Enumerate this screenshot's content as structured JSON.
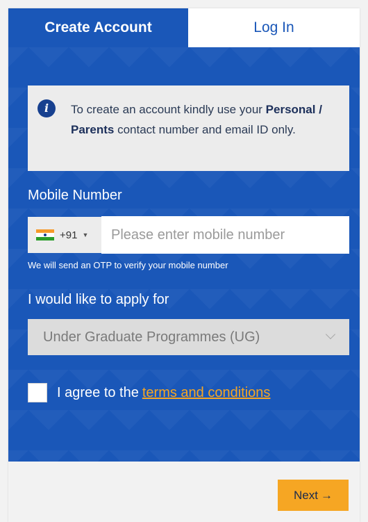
{
  "tabs": {
    "create_account": "Create Account",
    "log_in": "Log In"
  },
  "info": {
    "text_before": "To create an account kindly use your ",
    "text_bold": "Personal / Parents",
    "text_after": " contact number and email ID only."
  },
  "mobile": {
    "label": "Mobile Number",
    "country_code": "+91",
    "country_flag": "india-flag-icon",
    "placeholder": "Please enter mobile number",
    "value": "",
    "hint": "We will send an OTP to verify your mobile number"
  },
  "apply": {
    "label": "I would like to apply for",
    "selected": "Under Graduate Programmes (UG)"
  },
  "agree": {
    "prefix": "I agree to the",
    "link_text": "terms and conditions",
    "checked": false
  },
  "footer": {
    "next_label": "Next",
    "next_arrow": "→"
  },
  "colors": {
    "primary_blue": "#1a57b8",
    "accent_orange": "#f6a623",
    "info_bg": "#ececec"
  }
}
